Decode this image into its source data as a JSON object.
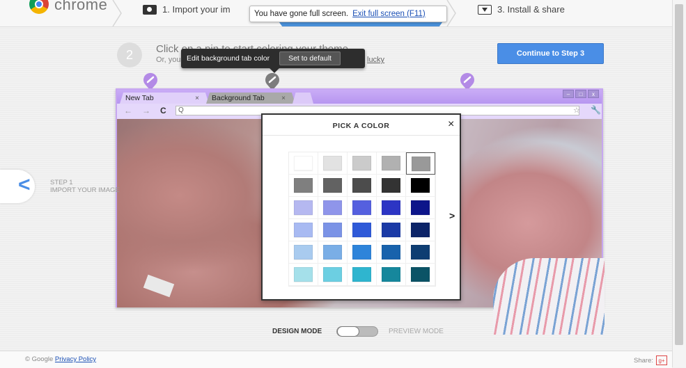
{
  "header": {
    "brand": "chrome",
    "step1_label": "1. Import your im",
    "step3_label": "3. Install & share"
  },
  "fullscreen_banner": {
    "message": "You have gone full screen.",
    "exit_link": "Exit full screen (F11)"
  },
  "instructions": {
    "step_number": "2",
    "title": "Click on a pin to start coloring your theme",
    "subtitle": "Or, you can",
    "lucky_link": "lucky"
  },
  "tooltip": {
    "text": "Edit background tab color",
    "button": "Set to default"
  },
  "continue_button": "Continue to Step 3",
  "mock_browser": {
    "tab1": "New Tab",
    "tab2": "Background Tab",
    "tab_close": "×",
    "omnibox": "Q",
    "back": "←",
    "forward": "→",
    "reload": "C",
    "star": "☆",
    "wrench": "🔧",
    "win_min": "–",
    "win_max": "□",
    "win_close": "x"
  },
  "left_nav": {
    "chevron": "<",
    "step": "STEP 1",
    "label": "IMPORT YOUR IMAGE"
  },
  "picker": {
    "title": "PICK A COLOR",
    "close": "×",
    "next": ">",
    "selected_index": 4,
    "swatches": [
      "#ffffff",
      "#e2e2e2",
      "#cbcbcb",
      "#b1b1b1",
      "#999999",
      "#7f7f7f",
      "#626262",
      "#4c4c4c",
      "#333333",
      "#000000",
      "#b5b8f0",
      "#8f95ea",
      "#5560df",
      "#2c35c4",
      "#0d158a",
      "#a8baf2",
      "#7b93e6",
      "#2f5ad8",
      "#1b3aa6",
      "#0c2468",
      "#a9cbef",
      "#7aaee6",
      "#2e84da",
      "#1862ac",
      "#0e3d72",
      "#a5e0ea",
      "#6ccfe2",
      "#2fb5cf",
      "#16879c",
      "#0b5366"
    ]
  },
  "mode_toggle": {
    "design": "DESIGN MODE",
    "preview": "PREVIEW MODE"
  },
  "footer": {
    "copyright": "© Google",
    "privacy": "Privacy Policy",
    "share": "Share:",
    "gplus": "g+"
  }
}
